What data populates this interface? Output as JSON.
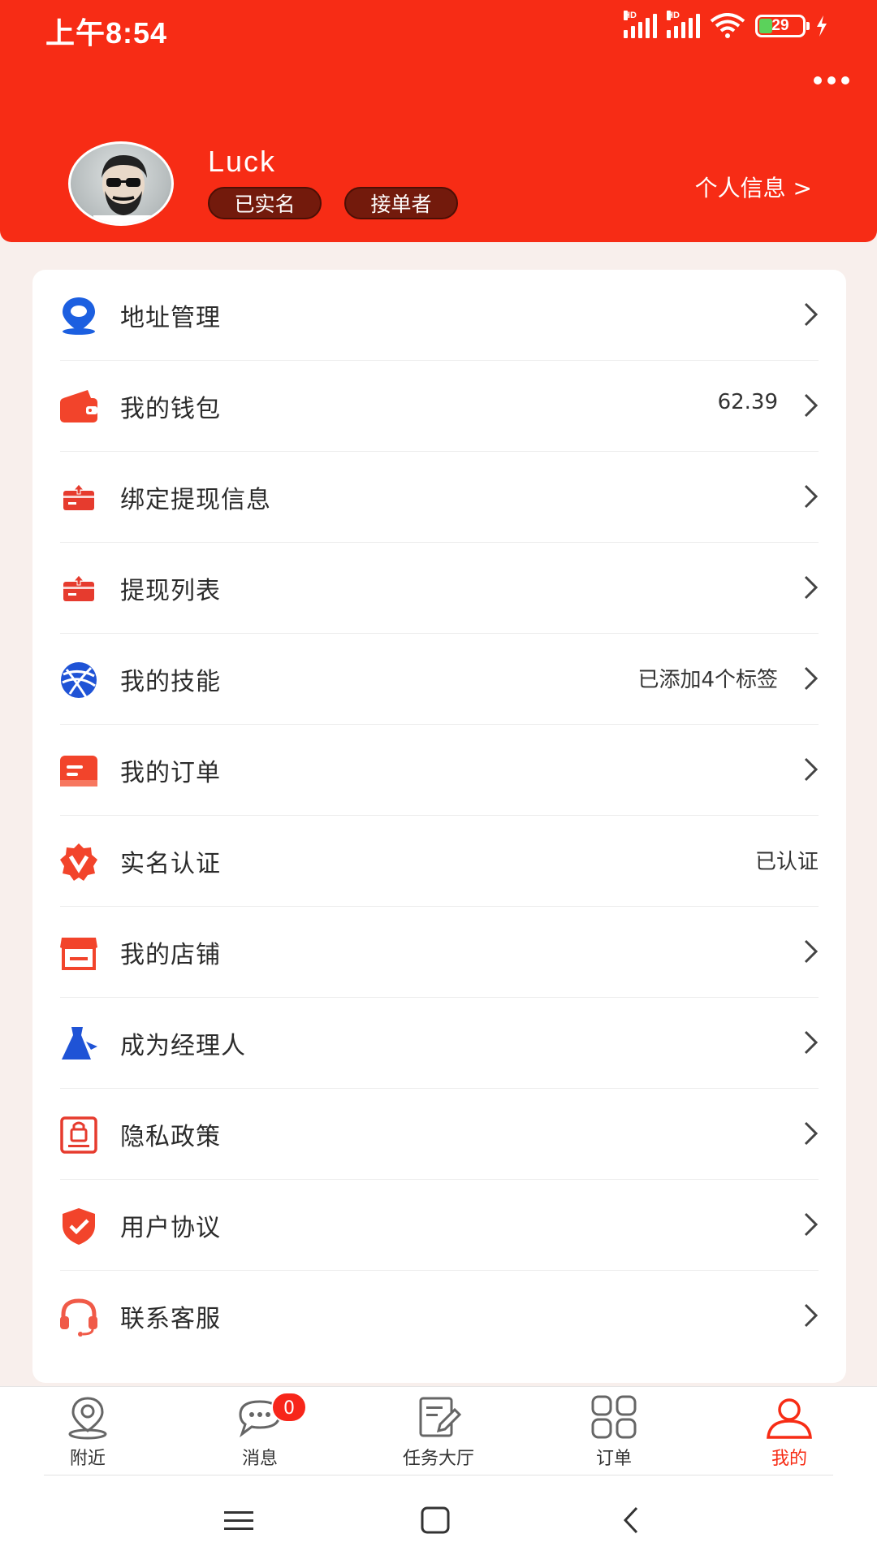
{
  "status_bar": {
    "time": "上午8:54",
    "network_1": "HD",
    "network_2": "HD",
    "battery": "29"
  },
  "header": {
    "username": "Luck",
    "tags": [
      "已实名",
      "接单者"
    ],
    "profile_link": "个人信息 >"
  },
  "menu": [
    {
      "label": "地址管理",
      "value": "",
      "icon": "location-pin-icon",
      "arrow": true
    },
    {
      "label": "我的钱包",
      "value": "62.39",
      "icon": "wallet-icon",
      "arrow": true
    },
    {
      "label": "绑定提现信息",
      "value": "",
      "icon": "withdraw-box-icon",
      "arrow": true
    },
    {
      "label": "提现列表",
      "value": "",
      "icon": "withdraw-list-icon",
      "arrow": true
    },
    {
      "label": "我的技能",
      "value": "已添加4个标签",
      "icon": "skill-ball-icon",
      "arrow": true
    },
    {
      "label": "我的订单",
      "value": "",
      "icon": "order-card-icon",
      "arrow": true
    },
    {
      "label": "实名认证",
      "value": "已认证",
      "icon": "verified-badge-icon",
      "arrow": false
    },
    {
      "label": "我的店铺",
      "value": "",
      "icon": "shop-icon",
      "arrow": true
    },
    {
      "label": "成为经理人",
      "value": "",
      "icon": "manager-tie-icon",
      "arrow": true
    },
    {
      "label": "隐私政策",
      "value": "",
      "icon": "privacy-lock-icon",
      "arrow": true
    },
    {
      "label": "用户协议",
      "value": "",
      "icon": "shield-check-icon",
      "arrow": true
    },
    {
      "label": "联系客服",
      "value": "",
      "icon": "headset-icon",
      "arrow": true
    }
  ],
  "bottom_nav": [
    {
      "label": "附近",
      "icon": "nearby-pin-icon",
      "active": false
    },
    {
      "label": "消息",
      "icon": "message-bubble-icon",
      "active": false,
      "badge": "0"
    },
    {
      "label": "任务大厅",
      "icon": "task-edit-icon",
      "active": false
    },
    {
      "label": "订单",
      "icon": "grid-icon",
      "active": false
    },
    {
      "label": "我的",
      "icon": "person-icon",
      "active": true
    }
  ],
  "colors": {
    "primary": "#f72c15",
    "tag_bg": "#731a0c",
    "page_bg": "#f8efec"
  }
}
